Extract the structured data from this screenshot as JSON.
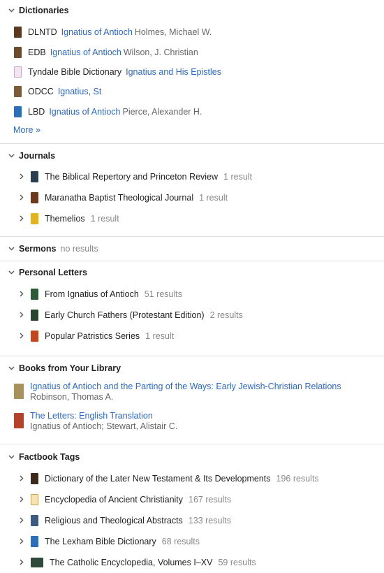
{
  "dictionaries": {
    "title": "Dictionaries",
    "items": [
      {
        "abbr": "DLNTD",
        "link": "Ignatius of Antioch",
        "author": "Holmes, Michael W.",
        "cover": "#5a3b22"
      },
      {
        "abbr": "EDB",
        "link": "Ignatius of Antioch",
        "author": "Wilson, J. Christian",
        "cover": "#6b4b2c"
      },
      {
        "abbr": "Tyndale Bible Dictionary",
        "link": "Ignatius and His Epistles",
        "author": "",
        "cover": "#c7a6c7"
      },
      {
        "abbr": "ODCC",
        "link": "Ignatius, St",
        "author": "",
        "cover": "#7a5c3a"
      },
      {
        "abbr": "LBD",
        "link": "Ignatius of Antioch",
        "author": "Pierce, Alexander H.",
        "cover": "#2d6fb6"
      }
    ],
    "more": "More »"
  },
  "journals": {
    "title": "Journals",
    "items": [
      {
        "title": "The Biblical Repertory and Princeton Review",
        "count": "1 result",
        "cover": "#2c3e50"
      },
      {
        "title": "Maranatha Baptist Theological Journal",
        "count": "1 result",
        "cover": "#6b3a1e"
      },
      {
        "title": "Themelios",
        "count": "1 result",
        "cover": "#e0b323"
      }
    ]
  },
  "sermons": {
    "title": "Sermons",
    "sub": "no results"
  },
  "personal_letters": {
    "title": "Personal Letters",
    "items": [
      {
        "title": "From Ignatius of Antioch",
        "count": "51 results",
        "cover": "#2e5a3a"
      },
      {
        "title": "Early Church Fathers (Protestant Edition)",
        "count": "2 results",
        "cover": "#27452f"
      },
      {
        "title": "Popular Patristics Series",
        "count": "1 result",
        "cover": "#c0461f"
      }
    ]
  },
  "books_library": {
    "title": "Books from Your Library",
    "items": [
      {
        "title": "Ignatius of Antioch and the Parting of the Ways: Early Jewish-Christian Relations",
        "author": "Robinson, Thomas A.",
        "cover": "#a8925a"
      },
      {
        "title": "The Letters: English Translation",
        "author": "Ignatius of Antioch; Stewart, Alistair C.",
        "cover": "#b5432a"
      }
    ]
  },
  "factbook": {
    "title": "Factbook Tags",
    "items": [
      {
        "title": "Dictionary of the Later New Testament & Its Developments",
        "count": "196 results",
        "cover": "#3b2a1c"
      },
      {
        "title": "Encyclopedia of Ancient Christianity",
        "count": "167 results",
        "cover": "#c9a456"
      },
      {
        "title": "Religious and Theological Abstracts",
        "count": "133 results",
        "cover": "#3d5a80"
      },
      {
        "title": "The Lexham Bible Dictionary",
        "count": "68 results",
        "cover": "#2d6fb6"
      },
      {
        "title": "The Catholic Encyclopedia, Volumes I–XV",
        "count": "59 results",
        "cover": "#2f4a3a"
      }
    ]
  }
}
